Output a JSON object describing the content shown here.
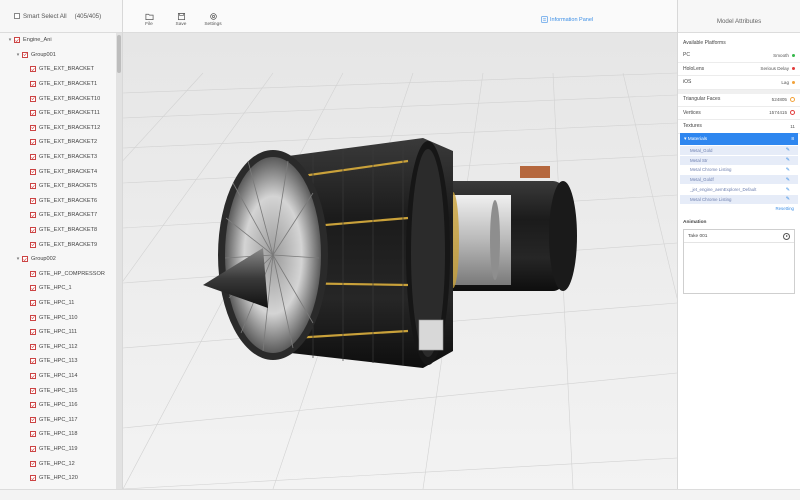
{
  "left_panel": {
    "smart_select_label": "Smart Select All",
    "selection_count": "(405/405)",
    "tree": [
      {
        "label": "Engine_Ani",
        "level": 0,
        "caret": "▾"
      },
      {
        "label": "Group001",
        "level": 1,
        "caret": "▾"
      },
      {
        "label": "GTE_EXT_BRACKET",
        "level": 2
      },
      {
        "label": "GTE_EXT_BRACKET1",
        "level": 2
      },
      {
        "label": "GTE_EXT_BRACKET10",
        "level": 2
      },
      {
        "label": "GTE_EXT_BRACKET11",
        "level": 2
      },
      {
        "label": "GTE_EXT_BRACKET12",
        "level": 2
      },
      {
        "label": "GTE_EXT_BRACKET2",
        "level": 2
      },
      {
        "label": "GTE_EXT_BRACKET3",
        "level": 2
      },
      {
        "label": "GTE_EXT_BRACKET4",
        "level": 2
      },
      {
        "label": "GTE_EXT_BRACKET5",
        "level": 2
      },
      {
        "label": "GTE_EXT_BRACKET6",
        "level": 2
      },
      {
        "label": "GTE_EXT_BRACKET7",
        "level": 2
      },
      {
        "label": "GTE_EXT_BRACKET8",
        "level": 2
      },
      {
        "label": "GTE_EXT_BRACKET9",
        "level": 2
      },
      {
        "label": "Group002",
        "level": 1,
        "caret": "▾"
      },
      {
        "label": "GTE_HP_COMPRESSOR",
        "level": 2
      },
      {
        "label": "GTE_HPC_1",
        "level": 2
      },
      {
        "label": "GTE_HPC_11",
        "level": 2
      },
      {
        "label": "GTE_HPC_110",
        "level": 2
      },
      {
        "label": "GTE_HPC_111",
        "level": 2
      },
      {
        "label": "GTE_HPC_112",
        "level": 2
      },
      {
        "label": "GTE_HPC_113",
        "level": 2
      },
      {
        "label": "GTE_HPC_114",
        "level": 2
      },
      {
        "label": "GTE_HPC_115",
        "level": 2
      },
      {
        "label": "GTE_HPC_116",
        "level": 2
      },
      {
        "label": "GTE_HPC_117",
        "level": 2
      },
      {
        "label": "GTE_HPC_118",
        "level": 2
      },
      {
        "label": "GTE_HPC_119",
        "level": 2
      },
      {
        "label": "GTE_HPC_12",
        "level": 2
      },
      {
        "label": "GTE_HPC_120",
        "level": 2
      }
    ]
  },
  "toolbar": {
    "file_label": "File",
    "save_label": "Save",
    "settings_label": "Settings",
    "info_panel_label": "Information Panel"
  },
  "right_panel": {
    "title": "Model Attributes",
    "platforms_label": "Available Platforms",
    "platforms": [
      {
        "name": "PC",
        "status": "Smooth",
        "color": "#35b84a"
      },
      {
        "name": "HoloLens",
        "status": "Serious Delay",
        "color": "#e23b3b"
      },
      {
        "name": "iOS",
        "status": "Lag",
        "color": "#f2a23a"
      }
    ],
    "stats": [
      {
        "label": "Triangular Faces",
        "value": "524805",
        "icon": "warning-circle-icon",
        "color": "#f2a23a"
      },
      {
        "label": "Vertices",
        "value": "1574415",
        "icon": "error-circle-icon",
        "color": "#e23b3b"
      },
      {
        "label": "Textures",
        "value": "11",
        "icon": "",
        "color": ""
      }
    ],
    "materials_label": "Materials",
    "materials_count": "8",
    "materials": [
      "Metal_Gold",
      "Metal Str",
      "Metal Chrome Listing",
      "Metal_Goldf",
      "_jet_engine_aemExplorer_Default",
      "Metal Chrome Listing"
    ],
    "reset_label": "Resetting",
    "animation_label": "Animation",
    "animations": [
      "Take 001"
    ]
  },
  "colors": {
    "accent": "#2e86ef",
    "engine_body": "#1f1f1f",
    "gold": "#c9a13a"
  }
}
